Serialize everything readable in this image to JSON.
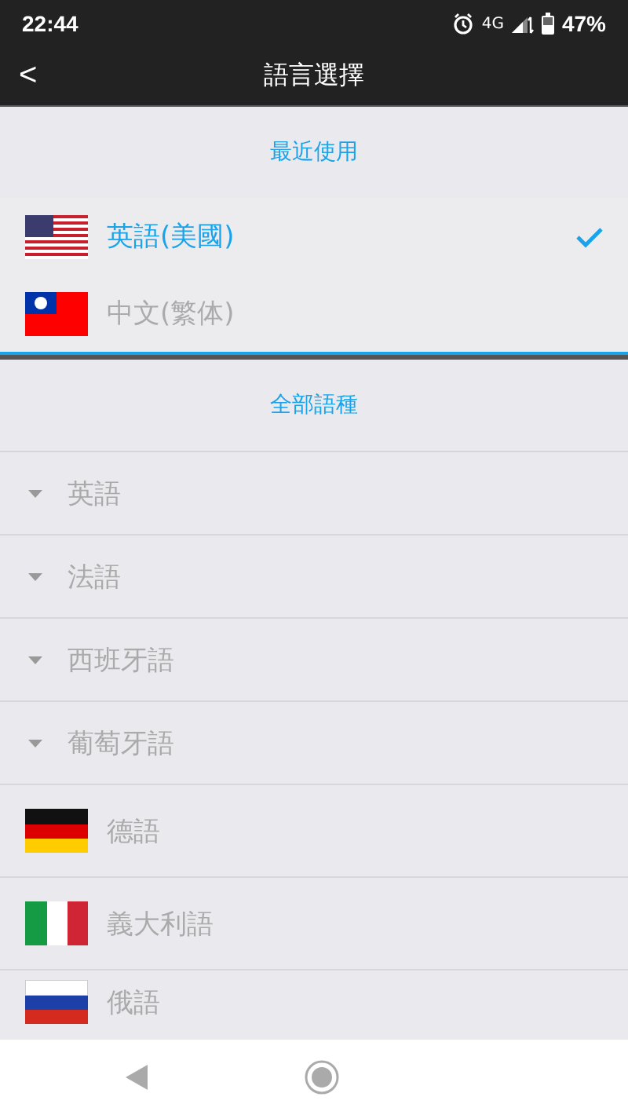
{
  "status_bar": {
    "time": "22:44",
    "network": "4G",
    "battery": "47%"
  },
  "app_bar": {
    "back": "<",
    "title": "語言選擇"
  },
  "recent": {
    "header": "最近使用",
    "items": [
      {
        "kind": "flag-us",
        "label": "英語(美國)",
        "selected": true
      },
      {
        "kind": "flag-tw",
        "label": "中文(繁体)",
        "selected": false
      }
    ]
  },
  "all": {
    "header": "全部語種",
    "items": [
      {
        "kind": "caret",
        "label": "英語",
        "selected": false
      },
      {
        "kind": "caret",
        "label": "法語",
        "selected": false
      },
      {
        "kind": "caret",
        "label": "西班牙語",
        "selected": false
      },
      {
        "kind": "caret",
        "label": "葡萄牙語",
        "selected": false
      },
      {
        "kind": "flag-de",
        "label": "德語",
        "selected": false
      },
      {
        "kind": "flag-it",
        "label": "義大利語",
        "selected": false
      },
      {
        "kind": "flag-ru",
        "label": "俄語",
        "selected": false
      }
    ]
  }
}
